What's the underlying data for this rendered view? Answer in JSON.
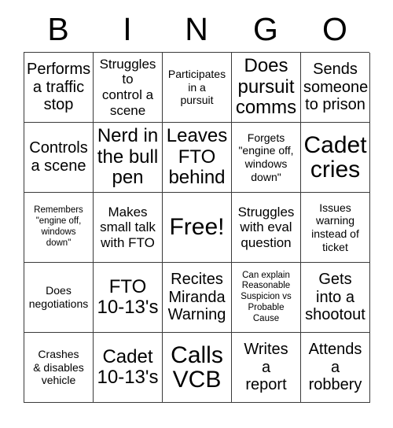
{
  "header": {
    "letters": [
      "B",
      "I",
      "N",
      "G",
      "O"
    ]
  },
  "grid": {
    "rows": [
      {
        "cells": [
          {
            "text": "Performs\na traffic\nstop",
            "size": "lg"
          },
          {
            "text": "Struggles\nto\ncontrol a\nscene",
            "size": "md"
          },
          {
            "text": "Participates\nin a\npursuit",
            "size": "sm"
          },
          {
            "text": "Does\npursuit\ncomms",
            "size": "xl"
          },
          {
            "text": "Sends\nsomeone\nto prison",
            "size": "lg"
          }
        ]
      },
      {
        "cells": [
          {
            "text": "Controls\na scene",
            "size": "lg"
          },
          {
            "text": "Nerd in\nthe bull\npen",
            "size": "xl"
          },
          {
            "text": "Leaves\nFTO\nbehind",
            "size": "xl"
          },
          {
            "text": "Forgets\n\"engine off,\nwindows\ndown\"",
            "size": "sm"
          },
          {
            "text": "Cadet\ncries",
            "size": "xxl"
          }
        ]
      },
      {
        "cells": [
          {
            "text": "Remembers\n\"engine off,\nwindows\ndown\"",
            "size": "xs"
          },
          {
            "text": "Makes\nsmall talk\nwith FTO",
            "size": "md"
          },
          {
            "text": "Free!",
            "size": "xxl"
          },
          {
            "text": "Struggles\nwith eval\nquestion",
            "size": "md"
          },
          {
            "text": "Issues\nwarning\ninstead of\nticket",
            "size": "sm"
          }
        ]
      },
      {
        "cells": [
          {
            "text": "Does\nnegotiations",
            "size": "sm"
          },
          {
            "text": "FTO\n10-13's",
            "size": "xl"
          },
          {
            "text": "Recites\nMiranda\nWarning",
            "size": "lg"
          },
          {
            "text": "Can explain\nReasonable\nSuspicion vs\nProbable\nCause",
            "size": "xs"
          },
          {
            "text": "Gets\ninto a\nshootout",
            "size": "lg"
          }
        ]
      },
      {
        "cells": [
          {
            "text": "Crashes\n& disables\nvehicle",
            "size": "sm"
          },
          {
            "text": "Cadet\n10-13's",
            "size": "xl"
          },
          {
            "text": "Calls\nVCB",
            "size": "xxl"
          },
          {
            "text": "Writes\na\nreport",
            "size": "lg"
          },
          {
            "text": "Attends\na\nrobbery",
            "size": "lg"
          }
        ]
      }
    ]
  }
}
